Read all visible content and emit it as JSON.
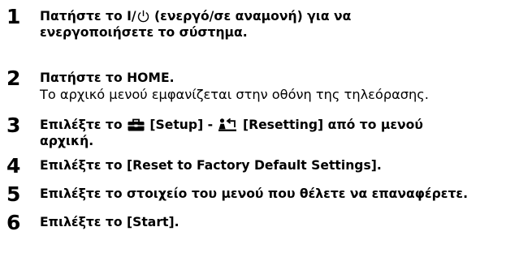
{
  "steps": [
    {
      "number": "1",
      "line1_pre": "Πατήστε το I/",
      "power_icon": "power-standby-icon",
      "line1_post": " (ενεργό/σε αναμονή) για να",
      "line2": "ενεργοποιήσετε το σύστημα."
    },
    {
      "number": "2",
      "line1": "Πατήστε το HOME.",
      "note": "Το αρχικό μενού εμφανίζεται στην οθόνη της τηλεόρασης."
    },
    {
      "number": "3",
      "line1_pre": "Επιλέξτε το ",
      "setup_icon": "toolbox-setup-icon",
      "line1_mid": " [Setup] - ",
      "resetting_icon": "resetting-icon",
      "line1_post": " [Resetting] από το μενού",
      "line2": "αρχική."
    },
    {
      "number": "4",
      "line1": "Επιλέξτε το [Reset to Factory Default Settings]."
    },
    {
      "number": "5",
      "line1": "Επιλέξτε το στοιχείο του μενού που θέλετε να επαναφέρετε."
    },
    {
      "number": "6",
      "line1": "Επιλέξτε το [Start]."
    }
  ],
  "colors": {
    "text": "#000000",
    "background": "#ffffff"
  }
}
